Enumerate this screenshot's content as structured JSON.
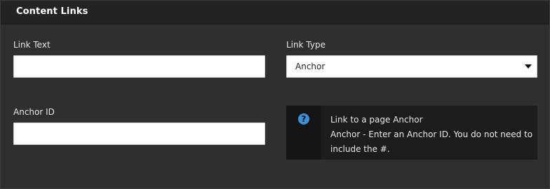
{
  "header": {
    "title": "Content Links"
  },
  "form": {
    "link_text": {
      "label": "Link Text",
      "value": ""
    },
    "link_type": {
      "label": "Link Type",
      "selected": "Anchor"
    },
    "anchor_id": {
      "label": "Anchor ID",
      "value": ""
    }
  },
  "help": {
    "icon": "question-circle-icon",
    "line1": "Link to a page Anchor",
    "line2": "Anchor - Enter an Anchor ID. You do not need to include the #."
  },
  "colors": {
    "background": "#2f2f2f",
    "header_bg": "#232323",
    "help_bg": "#1c1c1c",
    "help_icon": "#3b8fd6"
  }
}
